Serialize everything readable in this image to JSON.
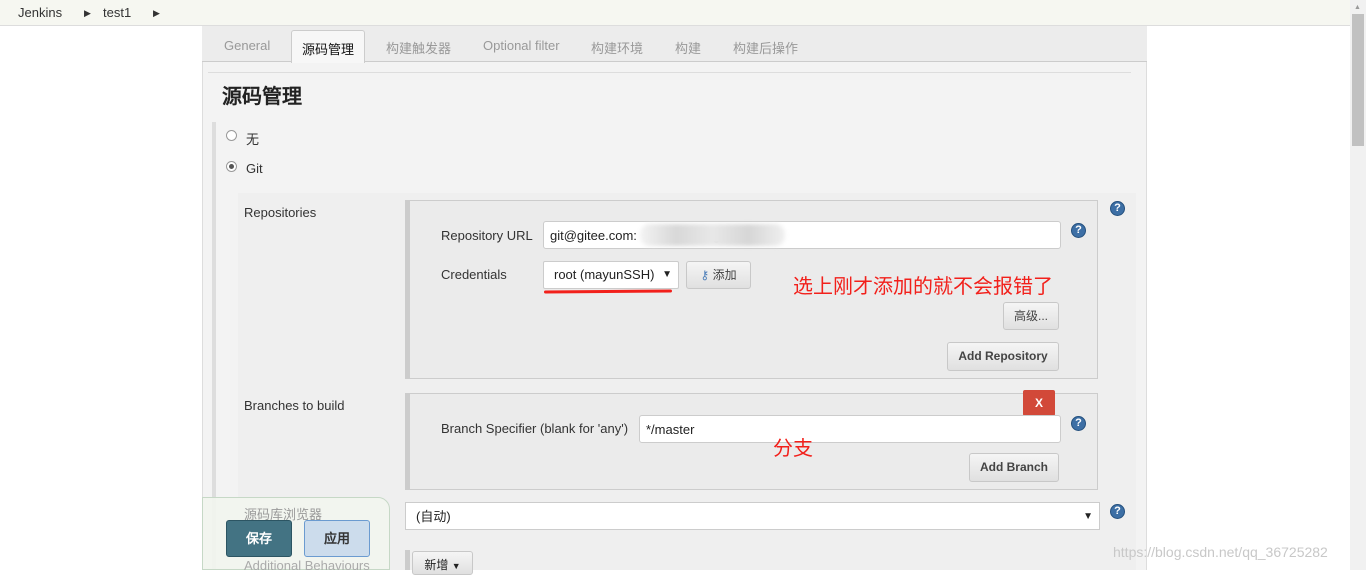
{
  "breadcrumb": [
    "Jenkins",
    "test1"
  ],
  "tabs": [
    "General",
    "源码管理",
    "构建触发器",
    "Optional filter",
    "构建环境",
    "构建",
    "构建后操作"
  ],
  "active_tab": 1,
  "section_title": "源码管理",
  "scm_options": [
    {
      "label": "无",
      "selected": false
    },
    {
      "label": "Git",
      "selected": true
    }
  ],
  "repositories": {
    "label": "Repositories",
    "url_label": "Repository URL",
    "url_value": "git@gitee.com:                    .git",
    "credentials_label": "Credentials",
    "credentials_value": "root (mayunSSH)",
    "add_label": "添加",
    "advanced_label": "高级...",
    "add_repo_label": "Add Repository"
  },
  "branches": {
    "label": "Branches to build",
    "specifier_label": "Branch Specifier (blank for 'any')",
    "specifier_value": "*/master",
    "delete_label": "X",
    "add_branch_label": "Add Branch"
  },
  "browser": {
    "label": "源码库浏览器",
    "value": "(自动)"
  },
  "additional": {
    "label": "Additional Behaviours",
    "add_label": "新增"
  },
  "annotations": {
    "credentials_note": "选上刚才添加的就不会报错了",
    "branch_note": "分支",
    "accent": "#f2201b"
  },
  "footer": {
    "save_label": "保存",
    "apply_label": "应用"
  },
  "watermark": "https://blog.csdn.net/qq_36725282"
}
